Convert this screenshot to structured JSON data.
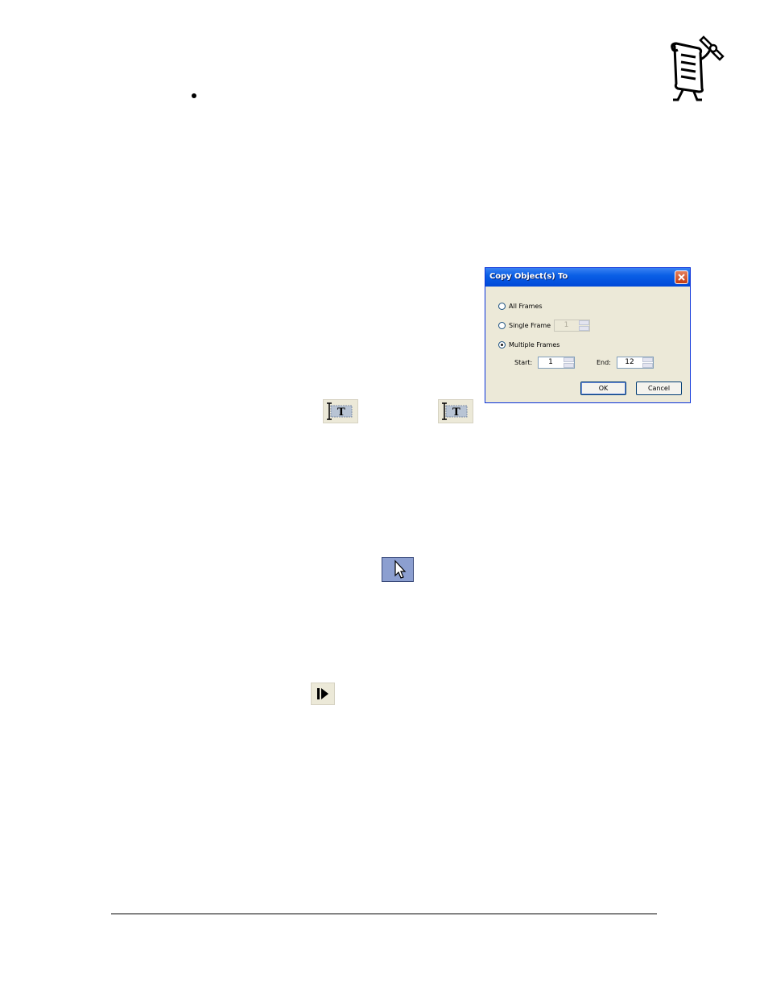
{
  "dialog": {
    "title": "Copy Object(s) To",
    "options": {
      "all_frames": "All Frames",
      "single_frame": "Single Frame",
      "multiple_frames": "Multiple Frames"
    },
    "selected_option": "multiple_frames",
    "single_frame_value": "1",
    "start_label": "Start:",
    "start_value": "1",
    "end_label": "End:",
    "end_value": "12",
    "ok_label": "OK",
    "cancel_label": "Cancel"
  },
  "icons": {
    "logo": "presenter-scroll-quill-icon",
    "text_tool_1": "text-frame-tool-icon",
    "text_tool_2": "text-frame-tool-icon",
    "select_tool": "selection-arrow-icon",
    "play_step": "step-forward-icon"
  },
  "colors": {
    "titlebar": "#0a5fe6",
    "dialog_bg": "#ece9d8",
    "select_tool_bg": "#8c9fd0"
  }
}
